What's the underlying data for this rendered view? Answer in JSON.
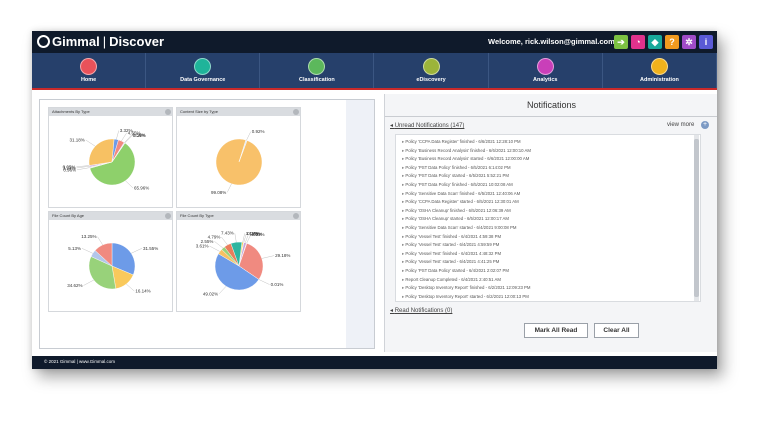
{
  "app": {
    "logo_text": "Gimmal",
    "product": "Discover",
    "welcome": "Welcome, rick.wilson@gimmal.com -"
  },
  "toolbar_icons": [
    {
      "name": "export-icon",
      "color": "#7cc142",
      "glyph": "➔"
    },
    {
      "name": "chart-icon",
      "color": "#e0328c",
      "glyph": "◔"
    },
    {
      "name": "tag-icon",
      "color": "#18a99b",
      "glyph": "◆"
    },
    {
      "name": "help-icon",
      "color": "#f29a1f",
      "glyph": "?"
    },
    {
      "name": "gear-icon",
      "color": "#a04cc8",
      "glyph": "✲"
    },
    {
      "name": "info-icon",
      "color": "#5a5ad6",
      "glyph": "i"
    }
  ],
  "nav": [
    {
      "label": "Home",
      "color": "#e9525a"
    },
    {
      "label": "Data Governance",
      "color": "#1fb49a"
    },
    {
      "label": "Classification",
      "color": "#5cb85c"
    },
    {
      "label": "eDiscovery",
      "color": "#9cb43a"
    },
    {
      "label": "Analytics",
      "color": "#c93fb9"
    },
    {
      "label": "Administration",
      "color": "#f0b21c"
    }
  ],
  "widgets": [
    {
      "title": "Attachments By Type",
      "chart_data": {
        "type": "pie",
        "values": [
          65.96,
          0.96,
          1.14,
          0.05,
          31.18,
          3.32,
          4.65,
          0.56,
          0.19
        ],
        "labels": [
          "65.96%",
          "0.96%",
          "1.14%",
          "0.05%",
          "31.18%",
          "3.32%",
          "4.65%",
          "0.56%",
          "0.19%"
        ],
        "colors": [
          "#8ed06b",
          "#e6e6e6",
          "#c7a3d9",
          "#f5c25a",
          "#f7c163",
          "#6d9be8",
          "#f08a80",
          "#b6c9e8",
          "#c4a8e0"
        ]
      }
    },
    {
      "title": "Content Size by Type",
      "chart_data": {
        "type": "pie",
        "values": [
          99.08,
          0.92
        ],
        "labels": [
          "99.08%",
          "0.92%"
        ],
        "colors": [
          "#f8c16a",
          "#dfe7f2"
        ]
      }
    },
    {
      "title": "File Count By Age",
      "chart_data": {
        "type": "pie",
        "values": [
          31.55,
          16.14,
          34.62,
          5.13,
          13.25
        ],
        "labels": [
          "31.55%",
          "16.14%",
          "34.62%",
          "5.13%",
          "13.25%"
        ],
        "colors": [
          "#6d9be8",
          "#f9c95c",
          "#98d27a",
          "#b3c6ea",
          "#f08a80"
        ]
      }
    },
    {
      "title": "File Count By Type",
      "chart_data": {
        "type": "pie",
        "values": [
          1.11,
          0.28,
          1.69,
          0.33,
          29.18,
          0.01,
          49.02,
          3.61,
          2.55,
          4.79,
          7.43
        ],
        "labels": [
          "1.11%",
          "0.28%",
          "1.69%",
          "0.33%",
          "29.18%",
          "0.01%",
          "49.02%",
          "3.61%",
          "2.55%",
          "4.79%",
          "7.43%"
        ],
        "colors": [
          "#f3d45a",
          "#f0a0b4",
          "#c7a3d9",
          "#e8e8e8",
          "#f08a80",
          "#ffffff",
          "#6d9be8",
          "#f7c163",
          "#98d27a",
          "#ea7d5b",
          "#2fb5a0"
        ]
      }
    }
  ],
  "notifications": {
    "title": "Notifications",
    "unread_label": "Unread Notifications (147)",
    "view_more": "view more",
    "items": [
      "Policy 'CCPA Data Register' finished - 6/6/2021 12:28:10 PM",
      "Policy 'Business Record Analysis' finished - 6/6/2021 12:00:10 AM",
      "Policy 'Business Record Analysis' started - 6/6/2021 12:00:00 AM",
      "Policy 'PST Data Policy' finished - 6/5/2021 6:14:02 PM",
      "Policy 'PST Data Policy' started - 6/5/2021 5:52:21 PM",
      "Policy 'PST Data Policy' finished - 6/5/2021 10:02:08 AM",
      "Policy 'Sensitive Data Scan' finished - 6/5/2021 12:40:06 AM",
      "Policy 'CCPA Data Register' started - 6/5/2021 12:30:01 AM",
      "Policy 'OSHA Cleanup' finished - 6/5/2021 12:06:39 AM",
      "Policy 'OSHA Cleanup' started - 6/5/2021 12:00:17 AM",
      "Policy 'Sensitive Data Scan' started - 6/4/2021 9:00:08 PM",
      "Policy 'Vessel Test' finished - 6/4/2021 4:59:38 PM",
      "Policy 'Vessel Test' started - 6/4/2021 4:59:59 PM",
      "Policy 'Vessel Test' finished - 6/4/2021 4:48:32 PM",
      "Policy 'Vessel Test' started - 6/4/2021 4:41:25 PM",
      "Policy 'PST Data Policy' started - 6/4/2021 2:02:07 PM",
      "Report Cleanup Completed - 6/4/2021 2:40:51 AM",
      "Policy 'Desktop Inventory Report' finished - 6/2/2021 12:09:23 PM",
      "Policy 'Desktop Inventory Report' started - 6/2/2021 12:00:13 PM"
    ],
    "read_label": "Read Notifications (0)",
    "mark_all": "Mark All Read",
    "clear_all": "Clear All"
  },
  "footer": "© 2021 Gimmal | www.Gimmal.com"
}
